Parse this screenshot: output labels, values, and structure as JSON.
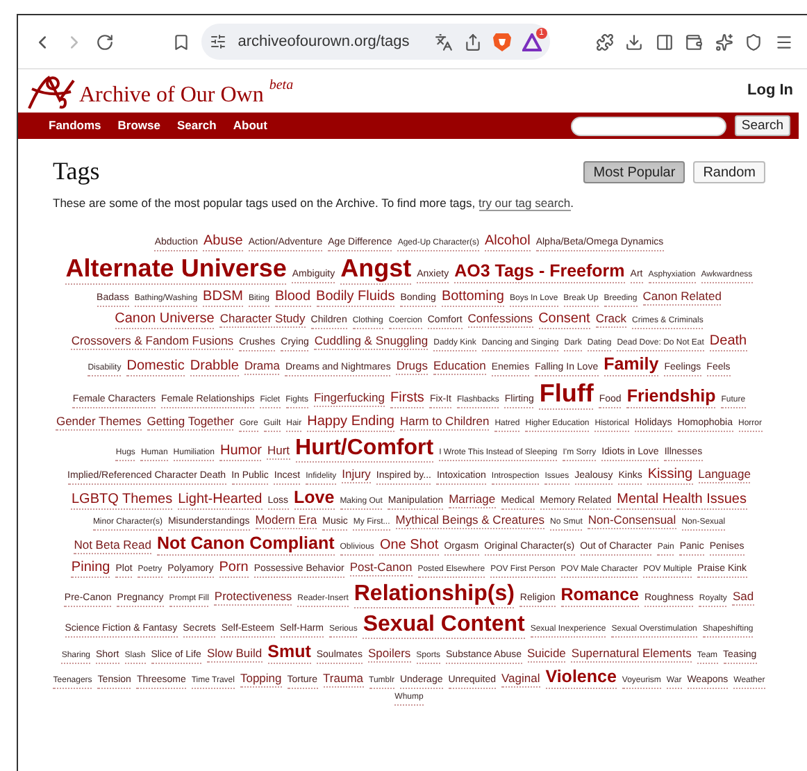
{
  "browser": {
    "url": "archiveofourown.org/tags",
    "badge": "1"
  },
  "header": {
    "site_title": "Archive of Our Own",
    "site_suffix": "beta",
    "login": "Log In"
  },
  "nav": {
    "items": [
      "Fandoms",
      "Browse",
      "Search",
      "About"
    ],
    "search_button": "Search"
  },
  "page": {
    "title": "Tags",
    "sort_buttons": [
      {
        "label": "Most Popular",
        "selected": true
      },
      {
        "label": "Random",
        "selected": false
      }
    ],
    "intro": "These are some of the most popular tags used on the Archive. To find more tags, ",
    "intro_link": "try our tag search",
    "intro_end": "."
  },
  "tags": [
    {
      "label": "Abduction",
      "kind": "small"
    },
    {
      "label": "Abuse",
      "kind": "large"
    },
    {
      "label": "Action/Adventure",
      "kind": "small"
    },
    {
      "label": "Age Difference",
      "kind": "small"
    },
    {
      "label": "Aged-Up Character(s)",
      "kind": "tiny"
    },
    {
      "label": "Alcohol",
      "kind": "large"
    },
    {
      "label": "Alpha/Beta/Omega Dynamics",
      "kind": "small"
    },
    {
      "label": "Alternate Universe",
      "kind": "giant"
    },
    {
      "label": "Ambiguity",
      "kind": "small"
    },
    {
      "label": "Angst",
      "kind": "giant"
    },
    {
      "label": "Anxiety",
      "kind": "small"
    },
    {
      "label": "AO3 Tags - Freeform",
      "kind": "big"
    },
    {
      "label": "Art",
      "kind": "small"
    },
    {
      "label": "Asphyxiation",
      "kind": "tiny"
    },
    {
      "label": "Awkwardness",
      "kind": "tiny"
    },
    {
      "label": "Badass",
      "kind": "small"
    },
    {
      "label": "Bathing/Washing",
      "kind": "tiny"
    },
    {
      "label": "BDSM",
      "kind": "large"
    },
    {
      "label": "Biting",
      "kind": "tiny"
    },
    {
      "label": "Blood",
      "kind": "large"
    },
    {
      "label": "Bodily Fluids",
      "kind": "large"
    },
    {
      "label": "Bonding",
      "kind": "small"
    },
    {
      "label": "Bottoming",
      "kind": "large"
    },
    {
      "label": "Boys In Love",
      "kind": "tiny"
    },
    {
      "label": "Break Up",
      "kind": "tiny"
    },
    {
      "label": "Breeding",
      "kind": "tiny"
    },
    {
      "label": "Canon Related",
      "kind": "medium"
    },
    {
      "label": "Canon Universe",
      "kind": "large"
    },
    {
      "label": "Character Study",
      "kind": "medium"
    },
    {
      "label": "Children",
      "kind": "small"
    },
    {
      "label": "Clothing",
      "kind": "tiny"
    },
    {
      "label": "Coercion",
      "kind": "tiny"
    },
    {
      "label": "Comfort",
      "kind": "small"
    },
    {
      "label": "Confessions",
      "kind": "medium"
    },
    {
      "label": "Consent",
      "kind": "large"
    },
    {
      "label": "Crack",
      "kind": "medium"
    },
    {
      "label": "Crimes & Criminals",
      "kind": "tiny"
    },
    {
      "label": "Crossovers & Fandom Fusions",
      "kind": "medium"
    },
    {
      "label": "Crushes",
      "kind": "small"
    },
    {
      "label": "Crying",
      "kind": "small"
    },
    {
      "label": "Cuddling & Snuggling",
      "kind": "medium"
    },
    {
      "label": "Daddy Kink",
      "kind": "tiny"
    },
    {
      "label": "Dancing and Singing",
      "kind": "tiny"
    },
    {
      "label": "Dark",
      "kind": "tiny"
    },
    {
      "label": "Dating",
      "kind": "tiny"
    },
    {
      "label": "Dead Dove: Do Not Eat",
      "kind": "tiny"
    },
    {
      "label": "Death",
      "kind": "large"
    },
    {
      "label": "Disability",
      "kind": "tiny"
    },
    {
      "label": "Domestic",
      "kind": "large"
    },
    {
      "label": "Drabble",
      "kind": "large"
    },
    {
      "label": "Drama",
      "kind": "medium"
    },
    {
      "label": "Dreams and Nightmares",
      "kind": "small"
    },
    {
      "label": "Drugs",
      "kind": "medium"
    },
    {
      "label": "Education",
      "kind": "medium"
    },
    {
      "label": "Enemies",
      "kind": "small"
    },
    {
      "label": "Falling In Love",
      "kind": "small"
    },
    {
      "label": "Family",
      "kind": "big"
    },
    {
      "label": "Feelings",
      "kind": "small"
    },
    {
      "label": "Feels",
      "kind": "small"
    },
    {
      "label": "Female Characters",
      "kind": "small"
    },
    {
      "label": "Female Relationships",
      "kind": "small"
    },
    {
      "label": "Ficlet",
      "kind": "tiny"
    },
    {
      "label": "Fights",
      "kind": "tiny"
    },
    {
      "label": "Fingerfucking",
      "kind": "medium"
    },
    {
      "label": "Firsts",
      "kind": "large"
    },
    {
      "label": "Fix-It",
      "kind": "small"
    },
    {
      "label": "Flashbacks",
      "kind": "tiny"
    },
    {
      "label": "Flirting",
      "kind": "small"
    },
    {
      "label": "Fluff",
      "kind": "giant"
    },
    {
      "label": "Food",
      "kind": "small"
    },
    {
      "label": "Friendship",
      "kind": "big"
    },
    {
      "label": "Future",
      "kind": "tiny"
    },
    {
      "label": "Gender Themes",
      "kind": "medium"
    },
    {
      "label": "Getting Together",
      "kind": "medium"
    },
    {
      "label": "Gore",
      "kind": "tiny"
    },
    {
      "label": "Guilt",
      "kind": "tiny"
    },
    {
      "label": "Hair",
      "kind": "tiny"
    },
    {
      "label": "Happy Ending",
      "kind": "large"
    },
    {
      "label": "Harm to Children",
      "kind": "medium"
    },
    {
      "label": "Hatred",
      "kind": "tiny"
    },
    {
      "label": "Higher Education",
      "kind": "tiny"
    },
    {
      "label": "Historical",
      "kind": "tiny"
    },
    {
      "label": "Holidays",
      "kind": "small"
    },
    {
      "label": "Homophobia",
      "kind": "small"
    },
    {
      "label": "Horror",
      "kind": "tiny"
    },
    {
      "label": "Hugs",
      "kind": "tiny"
    },
    {
      "label": "Human",
      "kind": "tiny"
    },
    {
      "label": "Humiliation",
      "kind": "tiny"
    },
    {
      "label": "Humor",
      "kind": "large"
    },
    {
      "label": "Hurt",
      "kind": "medium"
    },
    {
      "label": "Hurt/Comfort",
      "kind": "huge"
    },
    {
      "label": "I Wrote This Instead of Sleeping",
      "kind": "tiny"
    },
    {
      "label": "I'm Sorry",
      "kind": "tiny"
    },
    {
      "label": "Idiots in Love",
      "kind": "small"
    },
    {
      "label": "Illnesses",
      "kind": "small"
    },
    {
      "label": "Implied/Referenced Character Death",
      "kind": "small"
    },
    {
      "label": "In Public",
      "kind": "small"
    },
    {
      "label": "Incest",
      "kind": "small"
    },
    {
      "label": "Infidelity",
      "kind": "tiny"
    },
    {
      "label": "Injury",
      "kind": "medium"
    },
    {
      "label": "Inspired by...",
      "kind": "small"
    },
    {
      "label": "Intoxication",
      "kind": "small"
    },
    {
      "label": "Introspection",
      "kind": "tiny"
    },
    {
      "label": "Issues",
      "kind": "tiny"
    },
    {
      "label": "Jealousy",
      "kind": "small"
    },
    {
      "label": "Kinks",
      "kind": "small"
    },
    {
      "label": "Kissing",
      "kind": "large"
    },
    {
      "label": "Language",
      "kind": "medium"
    },
    {
      "label": "LGBTQ Themes",
      "kind": "large"
    },
    {
      "label": "Light-Hearted",
      "kind": "large"
    },
    {
      "label": "Loss",
      "kind": "small"
    },
    {
      "label": "Love",
      "kind": "big"
    },
    {
      "label": "Making Out",
      "kind": "tiny"
    },
    {
      "label": "Manipulation",
      "kind": "small"
    },
    {
      "label": "Marriage",
      "kind": "medium"
    },
    {
      "label": "Medical",
      "kind": "small"
    },
    {
      "label": "Memory Related",
      "kind": "small"
    },
    {
      "label": "Mental Health Issues",
      "kind": "large"
    },
    {
      "label": "Minor Character(s)",
      "kind": "tiny"
    },
    {
      "label": "Misunderstandings",
      "kind": "small"
    },
    {
      "label": "Modern Era",
      "kind": "medium"
    },
    {
      "label": "Music",
      "kind": "small"
    },
    {
      "label": "My First...",
      "kind": "tiny"
    },
    {
      "label": "Mythical Beings & Creatures",
      "kind": "medium"
    },
    {
      "label": "No Smut",
      "kind": "tiny"
    },
    {
      "label": "Non-Consensual",
      "kind": "medium"
    },
    {
      "label": "Non-Sexual",
      "kind": "tiny"
    },
    {
      "label": "Not Beta Read",
      "kind": "medium"
    },
    {
      "label": "Not Canon Compliant",
      "kind": "big"
    },
    {
      "label": "Oblivious",
      "kind": "tiny"
    },
    {
      "label": "One Shot",
      "kind": "large"
    },
    {
      "label": "Orgasm",
      "kind": "small"
    },
    {
      "label": "Original Character(s)",
      "kind": "small"
    },
    {
      "label": "Out of Character",
      "kind": "small"
    },
    {
      "label": "Pain",
      "kind": "tiny"
    },
    {
      "label": "Panic",
      "kind": "small"
    },
    {
      "label": "Penises",
      "kind": "small"
    },
    {
      "label": "Pining",
      "kind": "large"
    },
    {
      "label": "Plot",
      "kind": "small"
    },
    {
      "label": "Poetry",
      "kind": "tiny"
    },
    {
      "label": "Polyamory",
      "kind": "small"
    },
    {
      "label": "Porn",
      "kind": "large"
    },
    {
      "label": "Possessive Behavior",
      "kind": "small"
    },
    {
      "label": "Post-Canon",
      "kind": "medium"
    },
    {
      "label": "Posted Elsewhere",
      "kind": "tiny"
    },
    {
      "label": "POV First Person",
      "kind": "tiny"
    },
    {
      "label": "POV Male Character",
      "kind": "tiny"
    },
    {
      "label": "POV Multiple",
      "kind": "tiny"
    },
    {
      "label": "Praise Kink",
      "kind": "small"
    },
    {
      "label": "Pre-Canon",
      "kind": "small"
    },
    {
      "label": "Pregnancy",
      "kind": "small"
    },
    {
      "label": "Prompt Fill",
      "kind": "tiny"
    },
    {
      "label": "Protectiveness",
      "kind": "medium"
    },
    {
      "label": "Reader-Insert",
      "kind": "tiny"
    },
    {
      "label": "Relationship(s)",
      "kind": "huge"
    },
    {
      "label": "Religion",
      "kind": "small"
    },
    {
      "label": "Romance",
      "kind": "big"
    },
    {
      "label": "Roughness",
      "kind": "small"
    },
    {
      "label": "Royalty",
      "kind": "tiny"
    },
    {
      "label": "Sad",
      "kind": "medium"
    },
    {
      "label": "Science Fiction & Fantasy",
      "kind": "small"
    },
    {
      "label": "Secrets",
      "kind": "small"
    },
    {
      "label": "Self-Esteem",
      "kind": "small"
    },
    {
      "label": "Self-Harm",
      "kind": "small"
    },
    {
      "label": "Serious",
      "kind": "tiny"
    },
    {
      "label": "Sexual Content",
      "kind": "huge"
    },
    {
      "label": "Sexual Inexperience",
      "kind": "tiny"
    },
    {
      "label": "Sexual Overstimulation",
      "kind": "tiny"
    },
    {
      "label": "Shapeshifting",
      "kind": "tiny"
    },
    {
      "label": "Sharing",
      "kind": "tiny"
    },
    {
      "label": "Short",
      "kind": "small"
    },
    {
      "label": "Slash",
      "kind": "tiny"
    },
    {
      "label": "Slice of Life",
      "kind": "small"
    },
    {
      "label": "Slow Build",
      "kind": "medium"
    },
    {
      "label": "Smut",
      "kind": "big"
    },
    {
      "label": "Soulmates",
      "kind": "small"
    },
    {
      "label": "Spoilers",
      "kind": "medium"
    },
    {
      "label": "Sports",
      "kind": "tiny"
    },
    {
      "label": "Substance Abuse",
      "kind": "small"
    },
    {
      "label": "Suicide",
      "kind": "medium"
    },
    {
      "label": "Supernatural Elements",
      "kind": "medium"
    },
    {
      "label": "Team",
      "kind": "tiny"
    },
    {
      "label": "Teasing",
      "kind": "small"
    },
    {
      "label": "Teenagers",
      "kind": "tiny"
    },
    {
      "label": "Tension",
      "kind": "small"
    },
    {
      "label": "Threesome",
      "kind": "small"
    },
    {
      "label": "Time Travel",
      "kind": "tiny"
    },
    {
      "label": "Topping",
      "kind": "medium"
    },
    {
      "label": "Torture",
      "kind": "small"
    },
    {
      "label": "Trauma",
      "kind": "medium"
    },
    {
      "label": "Tumblr",
      "kind": "tiny"
    },
    {
      "label": "Underage",
      "kind": "small"
    },
    {
      "label": "Unrequited",
      "kind": "small"
    },
    {
      "label": "Vaginal",
      "kind": "medium"
    },
    {
      "label": "Violence",
      "kind": "big"
    },
    {
      "label": "Voyeurism",
      "kind": "tiny"
    },
    {
      "label": "War",
      "kind": "tiny"
    },
    {
      "label": "Weapons",
      "kind": "small"
    },
    {
      "label": "Weather",
      "kind": "tiny"
    },
    {
      "label": "Whump",
      "kind": "tiny"
    }
  ]
}
